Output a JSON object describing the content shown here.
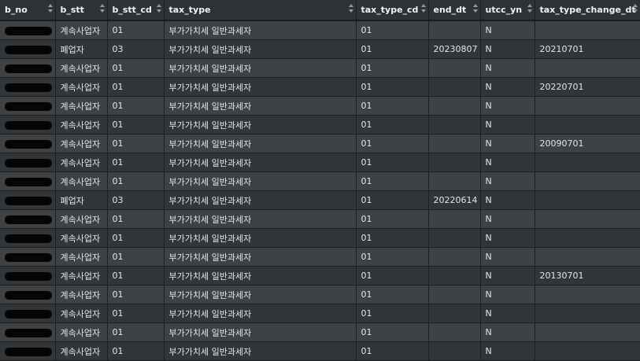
{
  "columns": [
    {
      "key": "b_no",
      "label": "b_no"
    },
    {
      "key": "b_stt",
      "label": "b_stt"
    },
    {
      "key": "b_stt_cd",
      "label": "b_stt_cd"
    },
    {
      "key": "tax_type",
      "label": "tax_type"
    },
    {
      "key": "tax_type_cd",
      "label": "tax_type_cd"
    },
    {
      "key": "end_dt",
      "label": "end_dt"
    },
    {
      "key": "utcc_yn",
      "label": "utcc_yn"
    },
    {
      "key": "tax_type_change_dt",
      "label": "tax_type_change_dt"
    }
  ],
  "rows": [
    [
      "",
      "계속사업자",
      "01",
      "부가가치세 일반과세자",
      "01",
      "",
      "N",
      ""
    ],
    [
      "",
      "폐업자",
      "03",
      "부가가치세 일반과세자",
      "01",
      "20230807",
      "N",
      "20210701"
    ],
    [
      "",
      "계속사업자",
      "01",
      "부가가치세 일반과세자",
      "01",
      "",
      "N",
      ""
    ],
    [
      "",
      "계속사업자",
      "01",
      "부가가치세 일반과세자",
      "01",
      "",
      "N",
      "20220701"
    ],
    [
      "",
      "계속사업자",
      "01",
      "부가가치세 일반과세자",
      "01",
      "",
      "N",
      ""
    ],
    [
      "",
      "계속사업자",
      "01",
      "부가가치세 일반과세자",
      "01",
      "",
      "N",
      ""
    ],
    [
      "",
      "계속사업자",
      "01",
      "부가가치세 일반과세자",
      "01",
      "",
      "N",
      "20090701"
    ],
    [
      "",
      "계속사업자",
      "01",
      "부가가치세 일반과세자",
      "01",
      "",
      "N",
      ""
    ],
    [
      "",
      "계속사업자",
      "01",
      "부가가치세 일반과세자",
      "01",
      "",
      "N",
      ""
    ],
    [
      "",
      "폐업자",
      "03",
      "부가가치세 일반과세자",
      "01",
      "20220614",
      "N",
      ""
    ],
    [
      "",
      "계속사업자",
      "01",
      "부가가치세 일반과세자",
      "01",
      "",
      "N",
      ""
    ],
    [
      "",
      "계속사업자",
      "01",
      "부가가치세 일반과세자",
      "01",
      "",
      "N",
      ""
    ],
    [
      "",
      "계속사업자",
      "01",
      "부가가치세 일반과세자",
      "01",
      "",
      "N",
      ""
    ],
    [
      "",
      "계속사업자",
      "01",
      "부가가치세 일반과세자",
      "01",
      "",
      "N",
      "20130701"
    ],
    [
      "",
      "계속사업자",
      "01",
      "부가가치세 일반과세자",
      "01",
      "",
      "N",
      ""
    ],
    [
      "",
      "계속사업자",
      "01",
      "부가가치세 일반과세자",
      "01",
      "",
      "N",
      ""
    ],
    [
      "",
      "계속사업자",
      "01",
      "부가가치세 일반과세자",
      "01",
      "",
      "N",
      ""
    ],
    [
      "",
      "계속사업자",
      "01",
      "부가가치세 일반과세자",
      "01",
      "",
      "N",
      ""
    ]
  ],
  "colors": {
    "header_bg": "#2f3234",
    "row_odd": "#3f4244",
    "row_even": "#333638",
    "grid_line": "#1e1f20",
    "redaction": "#050505"
  },
  "icons": {
    "sort": "sort-arrows-icon",
    "redaction": "redaction-bar"
  }
}
